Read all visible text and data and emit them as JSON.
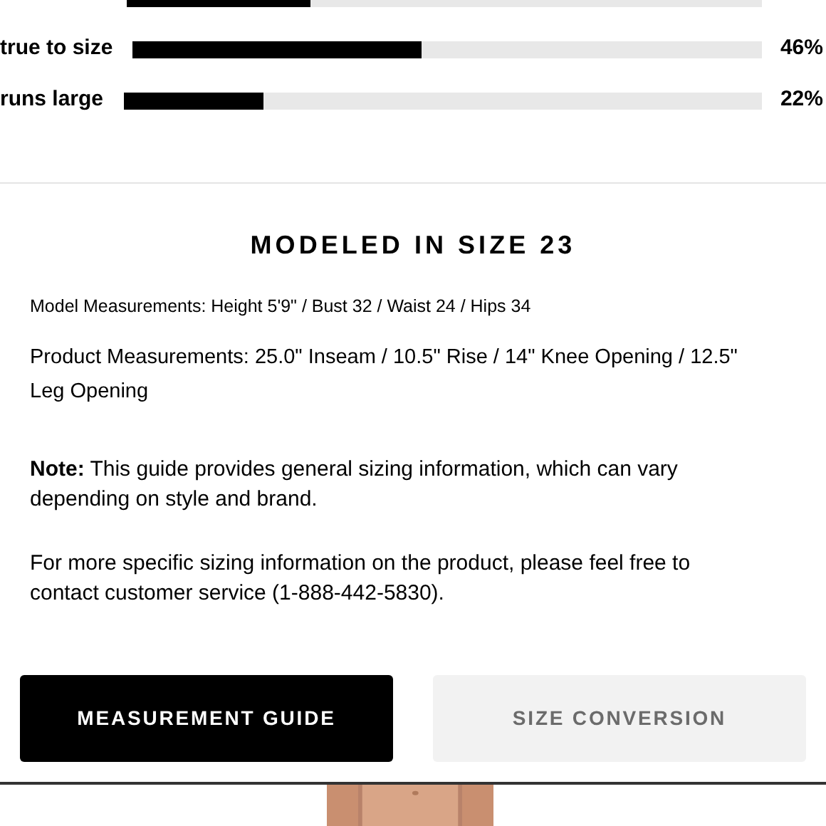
{
  "fit_ratings": [
    {
      "level": 0.29
    },
    {
      "label": "true to size",
      "level": 0.46,
      "percent": "46%"
    },
    {
      "label": "runs large",
      "level": 0.22,
      "percent": "22%"
    }
  ],
  "heading": "MODELED IN SIZE 23",
  "model_measurements": "Model Measurements: Height 5'9\" / Bust 32 / Waist 24 / Hips 34",
  "product_measurements": "Product Measurements: 25.0\" Inseam / 10.5\" Rise / 14\" Knee Opening / 12.5\" Leg Opening",
  "note": "**Note:** This guide provides general sizing information, which can vary depending on style and brand.",
  "contact": "For more specific sizing information on the product, please feel free to contact customer service (1-888-442-5830).",
  "buttons": [
    {
      "label": "MEASUREMENT GUIDE",
      "selected": true
    },
    {
      "label": "SIZE CONVERSION",
      "selected": false
    }
  ]
}
